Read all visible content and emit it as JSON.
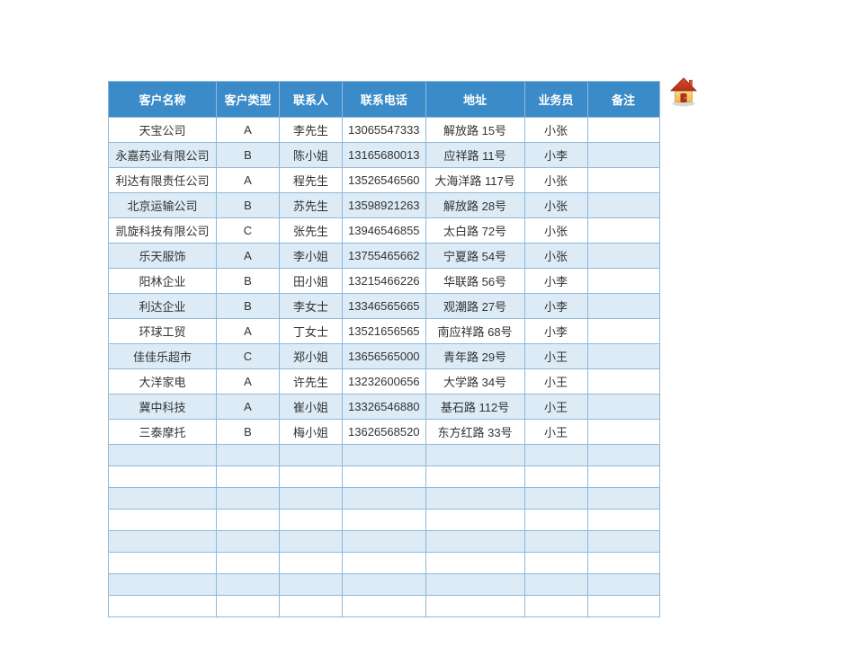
{
  "headers": {
    "customer_name": "客户名称",
    "customer_type": "客户类型",
    "contact": "联系人",
    "phone": "联系电话",
    "address": "地址",
    "sales": "业务员",
    "remark": "备注"
  },
  "rows": [
    {
      "customer_name": "天宝公司",
      "customer_type": "A",
      "contact": "李先生",
      "phone": "13065547333",
      "address": "解放路 15号",
      "sales": "小张",
      "remark": ""
    },
    {
      "customer_name": "永嘉药业有限公司",
      "customer_type": "B",
      "contact": "陈小姐",
      "phone": "13165680013",
      "address": "应祥路 11号",
      "sales": "小李",
      "remark": ""
    },
    {
      "customer_name": "利达有限责任公司",
      "customer_type": "A",
      "contact": "程先生",
      "phone": "13526546560",
      "address": "大海洋路 117号",
      "sales": "小张",
      "remark": ""
    },
    {
      "customer_name": "北京运输公司",
      "customer_type": "B",
      "contact": "苏先生",
      "phone": "13598921263",
      "address": "解放路 28号",
      "sales": "小张",
      "remark": ""
    },
    {
      "customer_name": "凯旋科技有限公司",
      "customer_type": "C",
      "contact": "张先生",
      "phone": "13946546855",
      "address": "太白路 72号",
      "sales": "小张",
      "remark": ""
    },
    {
      "customer_name": "乐天服饰",
      "customer_type": "A",
      "contact": "李小姐",
      "phone": "13755465662",
      "address": "宁夏路 54号",
      "sales": "小张",
      "remark": ""
    },
    {
      "customer_name": "阳林企业",
      "customer_type": "B",
      "contact": "田小姐",
      "phone": "13215466226",
      "address": "华联路 56号",
      "sales": "小李",
      "remark": ""
    },
    {
      "customer_name": "利达企业",
      "customer_type": "B",
      "contact": "李女士",
      "phone": "13346565665",
      "address": "观潮路 27号",
      "sales": "小李",
      "remark": ""
    },
    {
      "customer_name": "环球工贸",
      "customer_type": "A",
      "contact": "丁女士",
      "phone": "13521656565",
      "address": "南应祥路 68号",
      "sales": "小李",
      "remark": ""
    },
    {
      "customer_name": "佳佳乐超市",
      "customer_type": "C",
      "contact": "郑小姐",
      "phone": "13656565000",
      "address": "青年路 29号",
      "sales": "小王",
      "remark": ""
    },
    {
      "customer_name": "大洋家电",
      "customer_type": "A",
      "contact": "许先生",
      "phone": "13232600656",
      "address": "大学路 34号",
      "sales": "小王",
      "remark": ""
    },
    {
      "customer_name": "冀中科技",
      "customer_type": "A",
      "contact": "崔小姐",
      "phone": "13326546880",
      "address": "基石路 112号",
      "sales": "小王",
      "remark": ""
    },
    {
      "customer_name": "三泰摩托",
      "customer_type": "B",
      "contact": "梅小姐",
      "phone": "13626568520",
      "address": "东方红路 33号",
      "sales": "小王",
      "remark": ""
    }
  ],
  "empty_rows": 8,
  "colors": {
    "header_bg": "#3a8bc8",
    "row_alt_bg": "#dcebf6",
    "border": "#8fb9db"
  }
}
